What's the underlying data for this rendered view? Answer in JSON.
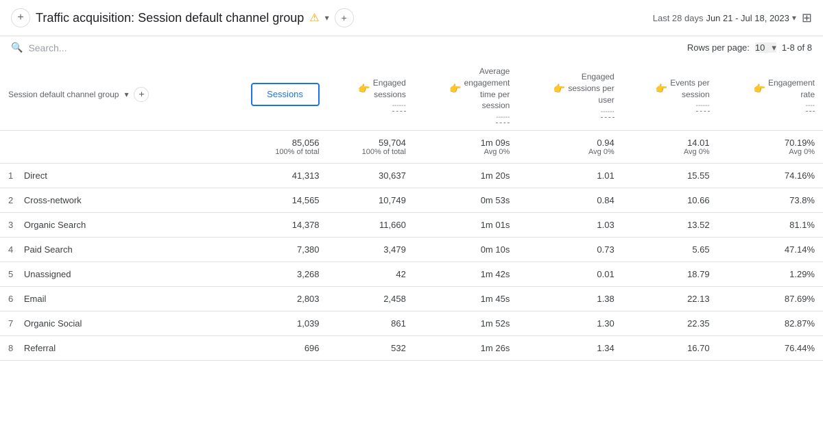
{
  "header": {
    "add_btn_label": "+",
    "title": "Traffic acquisition: Session default channel group",
    "warning_icon": "⚠",
    "dropdown_arrow": "▾",
    "add_tab_label": "+",
    "date_prefix": "Last 28 days",
    "date_range": "Jun 21 - Jul 18, 2023",
    "date_chevron": "▾",
    "chart_icon": "⊞"
  },
  "toolbar": {
    "search_placeholder": "Search...",
    "search_icon": "🔍",
    "rows_label": "Rows per page:",
    "rows_value": "10",
    "pagination": "1-8 of 8"
  },
  "table": {
    "dimension_col_label": "Session default channel group",
    "columns": [
      {
        "key": "sessions",
        "label": "Sessions",
        "highlighted": true
      },
      {
        "key": "engaged_sessions",
        "label": "Engaged sessions",
        "emoji": "👉"
      },
      {
        "key": "avg_engagement_time",
        "label": "Average engagement time per session",
        "emoji": "👉"
      },
      {
        "key": "engaged_sessions_per_user",
        "label": "Engaged sessions per user",
        "emoji": "👉"
      },
      {
        "key": "events_per_session",
        "label": "Events per session",
        "emoji": "👉"
      },
      {
        "key": "engagement_rate",
        "label": "Engagement rate",
        "emoji": "👉"
      }
    ],
    "totals": {
      "sessions": "85,056",
      "sessions_sub": "100% of total",
      "engaged_sessions": "59,704",
      "engaged_sessions_sub": "100% of total",
      "avg_engagement_time": "1m 09s",
      "avg_engagement_time_sub": "Avg 0%",
      "engaged_sessions_per_user": "0.94",
      "engaged_sessions_per_user_sub": "Avg 0%",
      "events_per_session": "14.01",
      "events_per_session_sub": "Avg 0%",
      "engagement_rate": "70.19%",
      "engagement_rate_sub": "Avg 0%"
    },
    "rows": [
      {
        "num": "1",
        "channel": "Direct",
        "sessions": "41,313",
        "engaged_sessions": "30,637",
        "avg_time": "1m 20s",
        "esp_user": "1.01",
        "eps": "15.55",
        "eng_rate": "74.16%"
      },
      {
        "num": "2",
        "channel": "Cross-network",
        "sessions": "14,565",
        "engaged_sessions": "10,749",
        "avg_time": "0m 53s",
        "esp_user": "0.84",
        "eps": "10.66",
        "eng_rate": "73.8%"
      },
      {
        "num": "3",
        "channel": "Organic Search",
        "sessions": "14,378",
        "engaged_sessions": "11,660",
        "avg_time": "1m 01s",
        "esp_user": "1.03",
        "eps": "13.52",
        "eng_rate": "81.1%"
      },
      {
        "num": "4",
        "channel": "Paid Search",
        "sessions": "7,380",
        "engaged_sessions": "3,479",
        "avg_time": "0m 10s",
        "esp_user": "0.73",
        "eps": "5.65",
        "eng_rate": "47.14%"
      },
      {
        "num": "5",
        "channel": "Unassigned",
        "sessions": "3,268",
        "engaged_sessions": "42",
        "avg_time": "1m 42s",
        "esp_user": "0.01",
        "eps": "18.79",
        "eng_rate": "1.29%"
      },
      {
        "num": "6",
        "channel": "Email",
        "sessions": "2,803",
        "engaged_sessions": "2,458",
        "avg_time": "1m 45s",
        "esp_user": "1.38",
        "eps": "22.13",
        "eng_rate": "87.69%"
      },
      {
        "num": "7",
        "channel": "Organic Social",
        "sessions": "1,039",
        "engaged_sessions": "861",
        "avg_time": "1m 52s",
        "esp_user": "1.30",
        "eps": "22.35",
        "eng_rate": "82.87%"
      },
      {
        "num": "8",
        "channel": "Referral",
        "sessions": "696",
        "engaged_sessions": "532",
        "avg_time": "1m 26s",
        "esp_user": "1.34",
        "eps": "16.70",
        "eng_rate": "76.44%"
      }
    ]
  }
}
